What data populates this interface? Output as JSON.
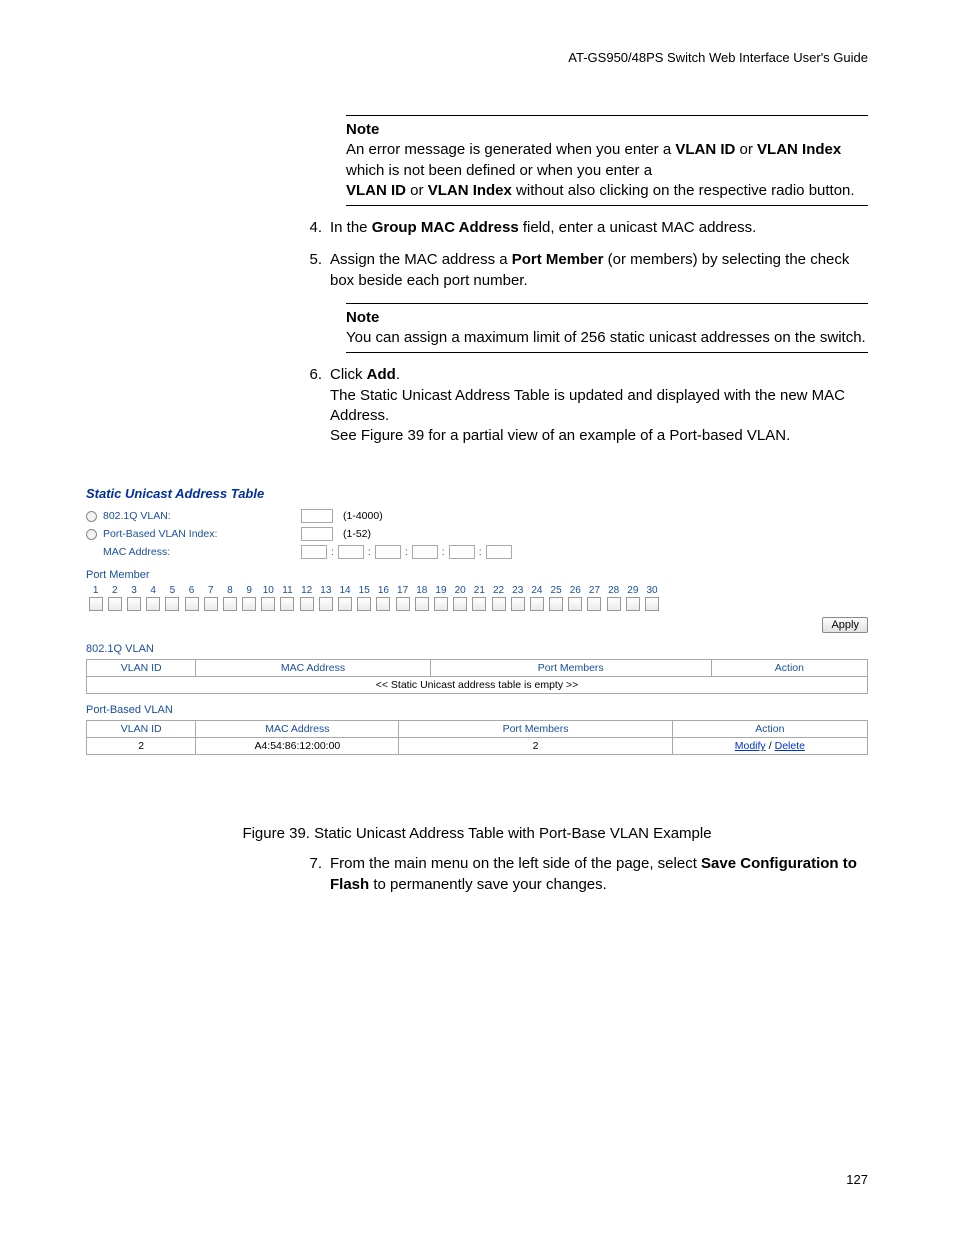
{
  "header": {
    "guide_title": "AT-GS950/48PS Switch Web Interface User's Guide"
  },
  "note1": {
    "title": "Note",
    "l1a": "An error message is generated when you enter a ",
    "l1b": "VLAN ID",
    "l1c": " or ",
    "l1d": "VLAN Index",
    "l1e": " which is not been defined or when you enter a ",
    "l2a": "VLAN ID",
    "l2b": " or ",
    "l2c": "VLAN Index",
    "l2d": " without also clicking on the respective radio button."
  },
  "step4": {
    "num": "4.",
    "a": "In the ",
    "b": "Group MAC Address",
    "c": " field, enter a unicast MAC address."
  },
  "step5": {
    "num": "5.",
    "a": "Assign the MAC address a ",
    "b": "Port Member",
    "c": " (or members) by selecting the check box beside each port number."
  },
  "note2": {
    "title": "Note",
    "text": "You can assign a maximum limit of 256 static unicast addresses on the switch."
  },
  "step6": {
    "num": "6.",
    "a": "Click ",
    "b": "Add",
    "c": ".",
    "line2": "The Static Unicast Address Table is updated and displayed with the new MAC Address.",
    "line3": "See Figure 39 for a partial view of an example of a Port-based VLAN."
  },
  "figure": {
    "title": "Static Unicast Address Table",
    "row_vlan": {
      "label": "802.1Q VLAN:",
      "hint": "(1-4000)"
    },
    "row_pb": {
      "label": "Port-Based VLAN Index:",
      "hint": "(1-52)"
    },
    "row_mac": {
      "label": "MAC Address:"
    },
    "port_member_label": "Port Member",
    "port_count": 30,
    "apply_label": "Apply",
    "section_8021q": "802.1Q VLAN",
    "tbl1": {
      "headers": [
        "VLAN ID",
        "MAC Address",
        "Port Members",
        "Action"
      ],
      "empty": "<< Static Unicast address table is empty >>"
    },
    "section_pb": "Port-Based VLAN",
    "tbl2": {
      "headers": [
        "VLAN ID",
        "MAC Address",
        "Port Members",
        "Action"
      ],
      "row": {
        "vlan_id": "2",
        "mac": "A4:54:86:12:00:00",
        "members": "2",
        "action_modify": "Modify",
        "action_sep": "/",
        "action_delete": "Delete"
      }
    }
  },
  "figure_caption": "Figure 39. Static Unicast Address Table with Port-Base VLAN Example",
  "step7": {
    "num": "7.",
    "a": "From the main menu on the left side of the page, select ",
    "b": "Save Configuration to Flash",
    "c": " to permanently save your changes."
  },
  "page_number": "127"
}
